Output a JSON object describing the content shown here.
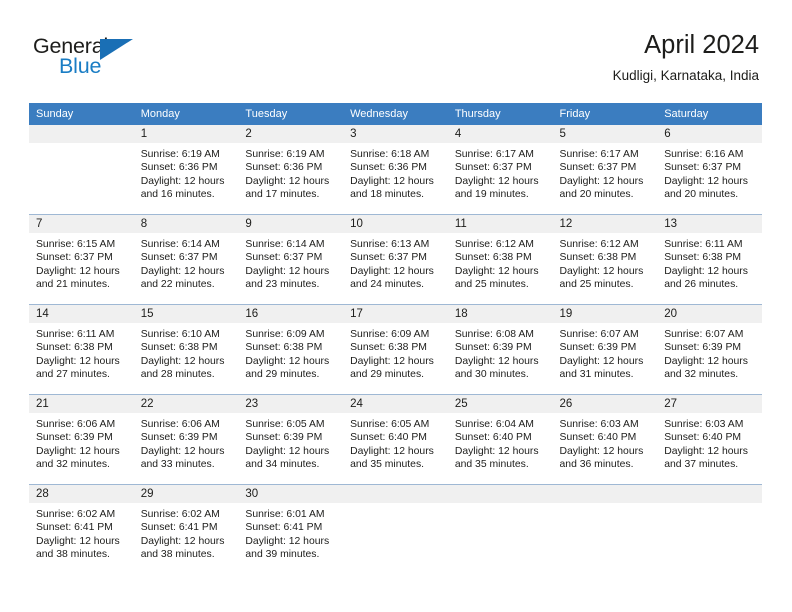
{
  "brand": {
    "name_part1": "General",
    "name_part2": "Blue"
  },
  "header": {
    "title": "April 2024",
    "subtitle": "Kudligi, Karnataka, India"
  },
  "colors": {
    "header_blue": "#3b7dc0",
    "logo_blue": "#1a7dc4",
    "daynum_band": "#f0f0f0",
    "grid_line": "#9fb8d4"
  },
  "weekday_headers": [
    "Sunday",
    "Monday",
    "Tuesday",
    "Wednesday",
    "Thursday",
    "Friday",
    "Saturday"
  ],
  "weeks": [
    [
      {
        "day": "",
        "sunrise": "",
        "sunset": "",
        "daylight_line1": "",
        "daylight_line2": ""
      },
      {
        "day": "1",
        "sunrise": "Sunrise: 6:19 AM",
        "sunset": "Sunset: 6:36 PM",
        "daylight_line1": "Daylight: 12 hours",
        "daylight_line2": "and 16 minutes."
      },
      {
        "day": "2",
        "sunrise": "Sunrise: 6:19 AM",
        "sunset": "Sunset: 6:36 PM",
        "daylight_line1": "Daylight: 12 hours",
        "daylight_line2": "and 17 minutes."
      },
      {
        "day": "3",
        "sunrise": "Sunrise: 6:18 AM",
        "sunset": "Sunset: 6:36 PM",
        "daylight_line1": "Daylight: 12 hours",
        "daylight_line2": "and 18 minutes."
      },
      {
        "day": "4",
        "sunrise": "Sunrise: 6:17 AM",
        "sunset": "Sunset: 6:37 PM",
        "daylight_line1": "Daylight: 12 hours",
        "daylight_line2": "and 19 minutes."
      },
      {
        "day": "5",
        "sunrise": "Sunrise: 6:17 AM",
        "sunset": "Sunset: 6:37 PM",
        "daylight_line1": "Daylight: 12 hours",
        "daylight_line2": "and 20 minutes."
      },
      {
        "day": "6",
        "sunrise": "Sunrise: 6:16 AM",
        "sunset": "Sunset: 6:37 PM",
        "daylight_line1": "Daylight: 12 hours",
        "daylight_line2": "and 20 minutes."
      }
    ],
    [
      {
        "day": "7",
        "sunrise": "Sunrise: 6:15 AM",
        "sunset": "Sunset: 6:37 PM",
        "daylight_line1": "Daylight: 12 hours",
        "daylight_line2": "and 21 minutes."
      },
      {
        "day": "8",
        "sunrise": "Sunrise: 6:14 AM",
        "sunset": "Sunset: 6:37 PM",
        "daylight_line1": "Daylight: 12 hours",
        "daylight_line2": "and 22 minutes."
      },
      {
        "day": "9",
        "sunrise": "Sunrise: 6:14 AM",
        "sunset": "Sunset: 6:37 PM",
        "daylight_line1": "Daylight: 12 hours",
        "daylight_line2": "and 23 minutes."
      },
      {
        "day": "10",
        "sunrise": "Sunrise: 6:13 AM",
        "sunset": "Sunset: 6:37 PM",
        "daylight_line1": "Daylight: 12 hours",
        "daylight_line2": "and 24 minutes."
      },
      {
        "day": "11",
        "sunrise": "Sunrise: 6:12 AM",
        "sunset": "Sunset: 6:38 PM",
        "daylight_line1": "Daylight: 12 hours",
        "daylight_line2": "and 25 minutes."
      },
      {
        "day": "12",
        "sunrise": "Sunrise: 6:12 AM",
        "sunset": "Sunset: 6:38 PM",
        "daylight_line1": "Daylight: 12 hours",
        "daylight_line2": "and 25 minutes."
      },
      {
        "day": "13",
        "sunrise": "Sunrise: 6:11 AM",
        "sunset": "Sunset: 6:38 PM",
        "daylight_line1": "Daylight: 12 hours",
        "daylight_line2": "and 26 minutes."
      }
    ],
    [
      {
        "day": "14",
        "sunrise": "Sunrise: 6:11 AM",
        "sunset": "Sunset: 6:38 PM",
        "daylight_line1": "Daylight: 12 hours",
        "daylight_line2": "and 27 minutes."
      },
      {
        "day": "15",
        "sunrise": "Sunrise: 6:10 AM",
        "sunset": "Sunset: 6:38 PM",
        "daylight_line1": "Daylight: 12 hours",
        "daylight_line2": "and 28 minutes."
      },
      {
        "day": "16",
        "sunrise": "Sunrise: 6:09 AM",
        "sunset": "Sunset: 6:38 PM",
        "daylight_line1": "Daylight: 12 hours",
        "daylight_line2": "and 29 minutes."
      },
      {
        "day": "17",
        "sunrise": "Sunrise: 6:09 AM",
        "sunset": "Sunset: 6:38 PM",
        "daylight_line1": "Daylight: 12 hours",
        "daylight_line2": "and 29 minutes."
      },
      {
        "day": "18",
        "sunrise": "Sunrise: 6:08 AM",
        "sunset": "Sunset: 6:39 PM",
        "daylight_line1": "Daylight: 12 hours",
        "daylight_line2": "and 30 minutes."
      },
      {
        "day": "19",
        "sunrise": "Sunrise: 6:07 AM",
        "sunset": "Sunset: 6:39 PM",
        "daylight_line1": "Daylight: 12 hours",
        "daylight_line2": "and 31 minutes."
      },
      {
        "day": "20",
        "sunrise": "Sunrise: 6:07 AM",
        "sunset": "Sunset: 6:39 PM",
        "daylight_line1": "Daylight: 12 hours",
        "daylight_line2": "and 32 minutes."
      }
    ],
    [
      {
        "day": "21",
        "sunrise": "Sunrise: 6:06 AM",
        "sunset": "Sunset: 6:39 PM",
        "daylight_line1": "Daylight: 12 hours",
        "daylight_line2": "and 32 minutes."
      },
      {
        "day": "22",
        "sunrise": "Sunrise: 6:06 AM",
        "sunset": "Sunset: 6:39 PM",
        "daylight_line1": "Daylight: 12 hours",
        "daylight_line2": "and 33 minutes."
      },
      {
        "day": "23",
        "sunrise": "Sunrise: 6:05 AM",
        "sunset": "Sunset: 6:39 PM",
        "daylight_line1": "Daylight: 12 hours",
        "daylight_line2": "and 34 minutes."
      },
      {
        "day": "24",
        "sunrise": "Sunrise: 6:05 AM",
        "sunset": "Sunset: 6:40 PM",
        "daylight_line1": "Daylight: 12 hours",
        "daylight_line2": "and 35 minutes."
      },
      {
        "day": "25",
        "sunrise": "Sunrise: 6:04 AM",
        "sunset": "Sunset: 6:40 PM",
        "daylight_line1": "Daylight: 12 hours",
        "daylight_line2": "and 35 minutes."
      },
      {
        "day": "26",
        "sunrise": "Sunrise: 6:03 AM",
        "sunset": "Sunset: 6:40 PM",
        "daylight_line1": "Daylight: 12 hours",
        "daylight_line2": "and 36 minutes."
      },
      {
        "day": "27",
        "sunrise": "Sunrise: 6:03 AM",
        "sunset": "Sunset: 6:40 PM",
        "daylight_line1": "Daylight: 12 hours",
        "daylight_line2": "and 37 minutes."
      }
    ],
    [
      {
        "day": "28",
        "sunrise": "Sunrise: 6:02 AM",
        "sunset": "Sunset: 6:41 PM",
        "daylight_line1": "Daylight: 12 hours",
        "daylight_line2": "and 38 minutes."
      },
      {
        "day": "29",
        "sunrise": "Sunrise: 6:02 AM",
        "sunset": "Sunset: 6:41 PM",
        "daylight_line1": "Daylight: 12 hours",
        "daylight_line2": "and 38 minutes."
      },
      {
        "day": "30",
        "sunrise": "Sunrise: 6:01 AM",
        "sunset": "Sunset: 6:41 PM",
        "daylight_line1": "Daylight: 12 hours",
        "daylight_line2": "and 39 minutes."
      },
      {
        "day": "",
        "sunrise": "",
        "sunset": "",
        "daylight_line1": "",
        "daylight_line2": ""
      },
      {
        "day": "",
        "sunrise": "",
        "sunset": "",
        "daylight_line1": "",
        "daylight_line2": ""
      },
      {
        "day": "",
        "sunrise": "",
        "sunset": "",
        "daylight_line1": "",
        "daylight_line2": ""
      },
      {
        "day": "",
        "sunrise": "",
        "sunset": "",
        "daylight_line1": "",
        "daylight_line2": ""
      }
    ]
  ]
}
